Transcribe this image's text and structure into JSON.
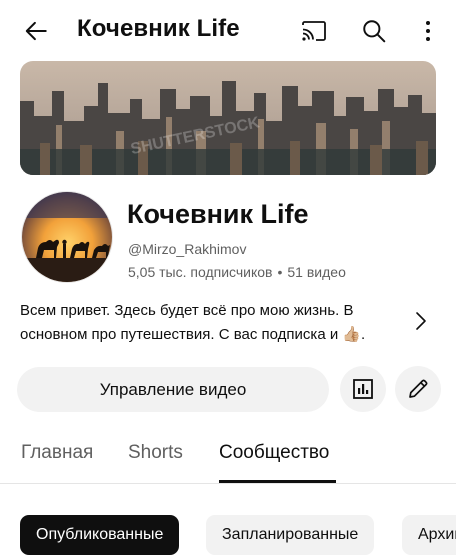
{
  "topbar": {
    "title": "Кочевник Life",
    "icons": [
      "back-arrow-icon",
      "cast-icon",
      "search-icon",
      "more-vertical-icon"
    ]
  },
  "banner": {
    "watermark": "SHUTTERSTOCK"
  },
  "channel": {
    "name": "Кочевник Life",
    "handle": "@Mirzo_Rakhimov",
    "subscribers": "5,05 тыс. подписчиков",
    "separator": "•",
    "videos": "51 видео",
    "description": "Всем привет. Здесь будет всё про мою жизнь. В основном про путешествия. С вас подписка и 👍🏼."
  },
  "actions": {
    "manage_label": "Управление видео",
    "stats_icon": "analytics-icon",
    "edit_icon": "edit-pencil-icon"
  },
  "tabs": [
    {
      "label": "Главная",
      "active": false
    },
    {
      "label": "Shorts",
      "active": false
    },
    {
      "label": "Сообщество",
      "active": true
    }
  ],
  "chips": [
    {
      "label": "Опубликованные",
      "selected": true
    },
    {
      "label": "Запланированные",
      "selected": false
    },
    {
      "label": "Архив",
      "selected": false
    }
  ],
  "colors": {
    "text": "#0f0f0f",
    "secondary": "#606060",
    "chip_bg": "#f2f2f2",
    "selected_bg": "#0f0f0f"
  }
}
